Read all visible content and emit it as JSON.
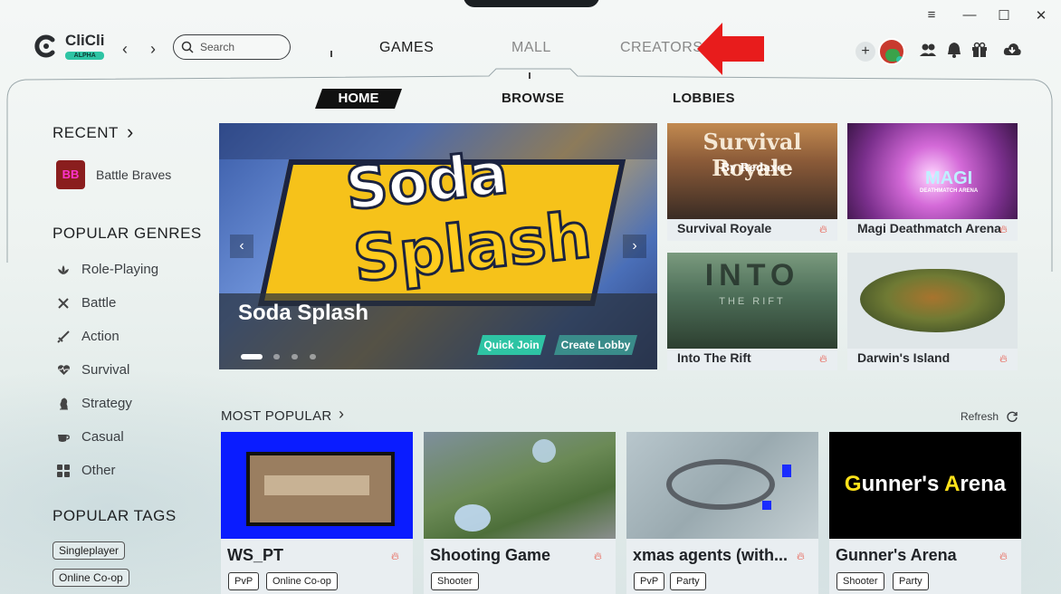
{
  "window": {
    "controls": [
      "≡",
      "—",
      "☐",
      "✕"
    ]
  },
  "logo": {
    "name": "CliCli",
    "badge": "ALPHA"
  },
  "search": {
    "placeholder": "Search"
  },
  "topnav": {
    "games": "GAMES",
    "mall": "MALL",
    "creators": "CREATORS"
  },
  "subtabs": {
    "home": "HOME",
    "browse": "BROWSE",
    "lobbies": "LOBBIES"
  },
  "sidebar": {
    "recent_heading": "RECENT",
    "recent_items": [
      {
        "label": "Battle Braves"
      }
    ],
    "genres_heading": "POPULAR GENRES",
    "genres": [
      {
        "label": "Role-Playing",
        "icon": "lotus-icon"
      },
      {
        "label": "Battle",
        "icon": "crossed-swords-icon"
      },
      {
        "label": "Action",
        "icon": "sword-icon"
      },
      {
        "label": "Survival",
        "icon": "heartbeat-icon"
      },
      {
        "label": "Strategy",
        "icon": "chess-icon"
      },
      {
        "label": "Casual",
        "icon": "cup-icon"
      },
      {
        "label": "Other",
        "icon": "grid-icon"
      }
    ],
    "tags_heading": "POPULAR TAGS",
    "tags": [
      "Singleplayer",
      "Online Co-op"
    ]
  },
  "hero": {
    "title": "Soda Splash",
    "art_word_1": "Soda",
    "art_word_2": "Splash",
    "quick_join": "Quick Join",
    "create_lobby": "Create Lobby",
    "active_slide": 1,
    "slide_count": 4
  },
  "featured": [
    {
      "title": "Survival Royale",
      "art_text": "Survival Royale",
      "art_sub": "By Redaxe"
    },
    {
      "title": "Magi Deathmatch Arena",
      "art_text": "MAGI",
      "art_sub": "DEATHMATCH ARENA"
    },
    {
      "title": "Into The Rift",
      "art_text": "INTO",
      "art_sub": "THE RIFT"
    },
    {
      "title": "Darwin's Island"
    }
  ],
  "most_popular": {
    "heading": "MOST POPULAR",
    "refresh": "Refresh",
    "items": [
      {
        "title": "WS_PT",
        "tags": [
          "PvP",
          "Online Co-op"
        ]
      },
      {
        "title": "Shooting Game",
        "tags": [
          "Shooter"
        ]
      },
      {
        "title": "xmas agents (with...",
        "tags": [
          "PvP",
          "Party"
        ]
      },
      {
        "title": "Gunner's Arena",
        "tags": [
          "Shooter",
          "Party"
        ],
        "art_text": "Gunner's Arena"
      }
    ]
  },
  "colors": {
    "accent_teal": "#2ec4a4",
    "hot_red": "#e84a3a",
    "arrow_red": "#e81c1c"
  }
}
